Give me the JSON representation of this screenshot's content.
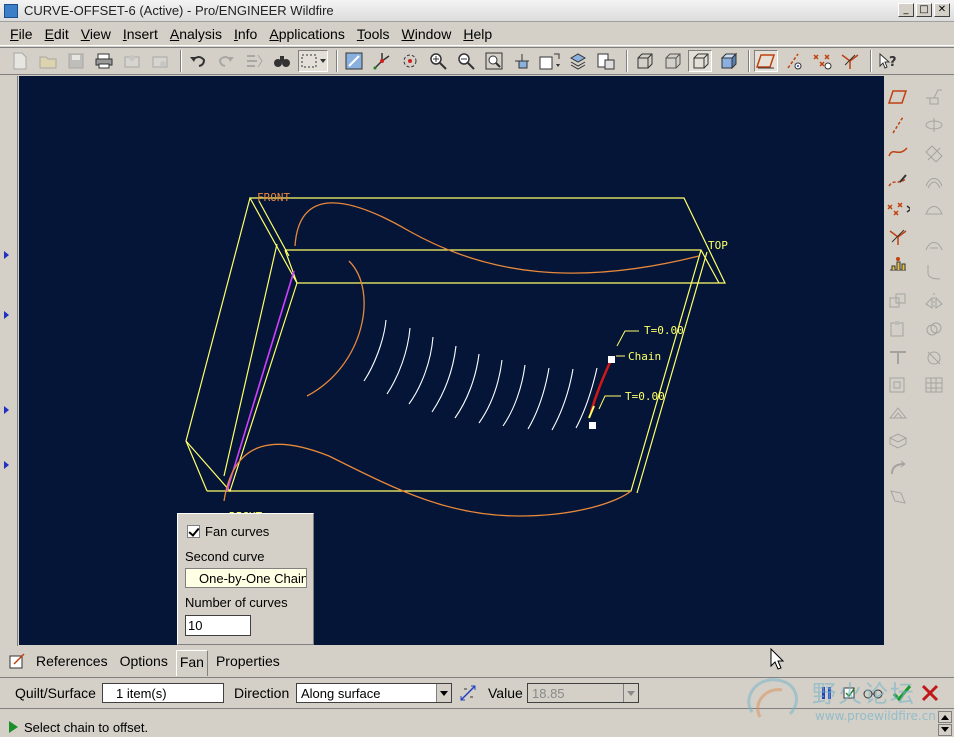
{
  "window": {
    "title": "CURVE-OFFSET-6 (Active) - Pro/ENGINEER Wildfire"
  },
  "menu": {
    "items": [
      {
        "label": "File",
        "u": "F",
        "rest": "ile"
      },
      {
        "label": "Edit",
        "u": "E",
        "rest": "dit"
      },
      {
        "label": "View",
        "u": "V",
        "rest": "iew"
      },
      {
        "label": "Insert",
        "u": "I",
        "rest": "nsert"
      },
      {
        "label": "Analysis",
        "u": "A",
        "rest": "nalysis"
      },
      {
        "label": "Info",
        "u": "I",
        "rest": "nfo"
      },
      {
        "label": "Applications",
        "u": "A",
        "rest": "pplications"
      },
      {
        "label": "Tools",
        "u": "T",
        "rest": "ools"
      },
      {
        "label": "Window",
        "u": "W",
        "rest": "indow"
      },
      {
        "label": "Help",
        "u": "H",
        "rest": "elp"
      }
    ]
  },
  "viewport": {
    "labels": {
      "front": "FRONT",
      "top": "TOP",
      "right": "RIGHT",
      "t_upper": "T=0.00",
      "t_lower": "T=0.00",
      "chain": "Chain"
    }
  },
  "fan_panel": {
    "fan_curves_label": "Fan curves",
    "fan_curves_checked": true,
    "second_curve_label": "Second curve",
    "second_curve_value": "One-by-One Chain",
    "num_curves_label": "Number of curves",
    "num_curves_value": "10"
  },
  "tabs": [
    {
      "label": "References",
      "active": false
    },
    {
      "label": "Options",
      "active": false
    },
    {
      "label": "Fan",
      "active": true
    },
    {
      "label": "Properties",
      "active": false
    }
  ],
  "dashboard": {
    "quilt_label": "Quilt/Surface",
    "quilt_value": "1 item(s)",
    "direction_label": "Direction",
    "direction_value": "Along surface",
    "value_label": "Value",
    "value_value": "18.85"
  },
  "status": {
    "message": "Select chain to offset."
  },
  "watermark": {
    "text": "野火论坛",
    "url": "www.proewildfire.cn"
  },
  "colors": {
    "viewport_bg": "#041538",
    "datum_yellow": "#ffff66",
    "curve_orange": "#e8883a",
    "fan_white": "#ffffff",
    "chain_red": "#d01818"
  }
}
